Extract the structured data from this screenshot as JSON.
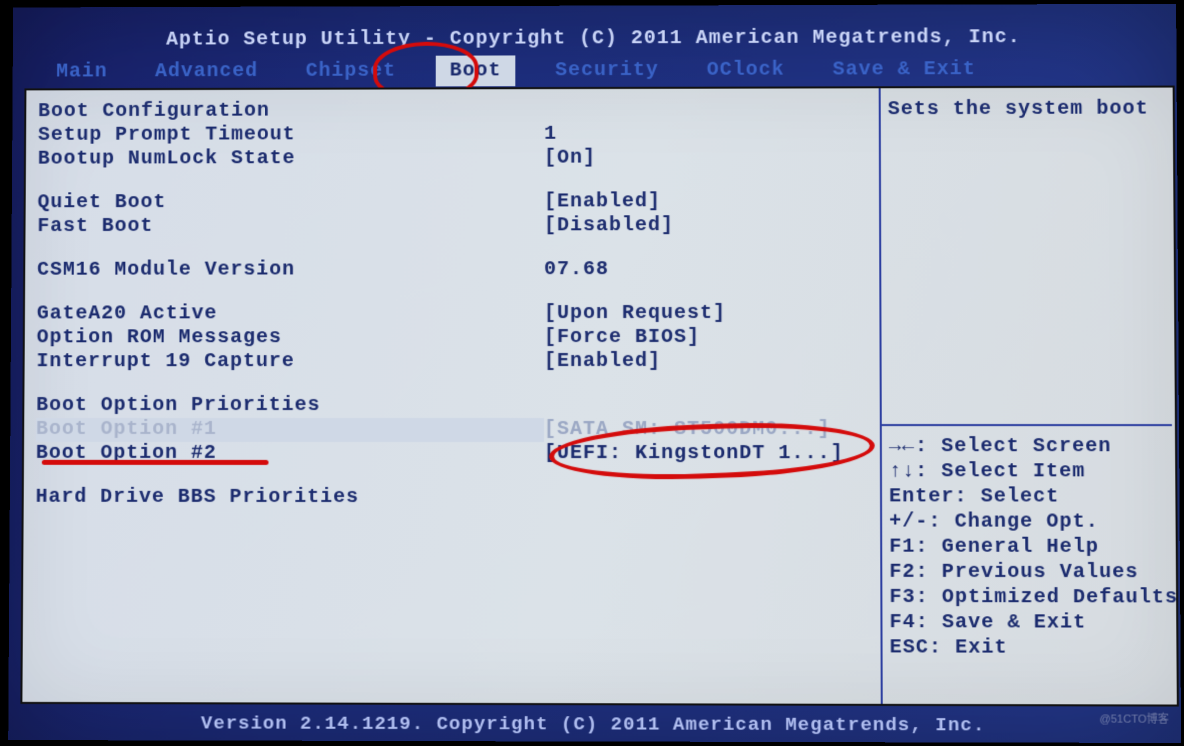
{
  "header": {
    "title": "Aptio Setup Utility - Copyright (C) 2011 American Megatrends, Inc."
  },
  "tabs": {
    "items": [
      "Main",
      "Advanced",
      "Chipset",
      "Boot",
      "Security",
      "OClock",
      "Save & Exit"
    ],
    "active_index": 3
  },
  "left_panel": {
    "section_boot_config": "Boot Configuration",
    "setup_prompt_timeout": {
      "label": "Setup Prompt Timeout",
      "value": "1"
    },
    "bootup_numlock": {
      "label": "Bootup NumLock State",
      "value": "[On]"
    },
    "quiet_boot": {
      "label": "Quiet Boot",
      "value": "[Enabled]"
    },
    "fast_boot": {
      "label": "Fast Boot",
      "value": "[Disabled]"
    },
    "csm16": {
      "label": "CSM16 Module Version",
      "value": "07.68"
    },
    "gatea20": {
      "label": "GateA20 Active",
      "value": "[Upon Request]"
    },
    "option_rom": {
      "label": "Option ROM Messages",
      "value": "[Force BIOS]"
    },
    "int19": {
      "label": "Interrupt 19 Capture",
      "value": "[Enabled]"
    },
    "section_priorities": "Boot Option Priorities",
    "boot1": {
      "label": "Boot Option #1",
      "value": "[SATA  SM: ST500DM0...]"
    },
    "boot2": {
      "label": "Boot Option #2",
      "value": "[UEFI: KingstonDT 1...]"
    },
    "hdd_bbs": "Hard Drive BBS Priorities"
  },
  "right_panel": {
    "help_text": "Sets the system boot",
    "keys": {
      "select_screen": "→←: Select Screen",
      "select_item": "↑↓: Select Item",
      "enter": "Enter: Select",
      "change": "+/-: Change Opt.",
      "f1": "F1: General Help",
      "f2": "F2: Previous Values",
      "f3": "F3: Optimized Defaults",
      "f4": "F4: Save & Exit",
      "esc": "ESC: Exit"
    }
  },
  "footer": {
    "text": "Version 2.14.1219. Copyright (C) 2011 American Megatrends, Inc."
  },
  "watermark": "@51CTO博客"
}
